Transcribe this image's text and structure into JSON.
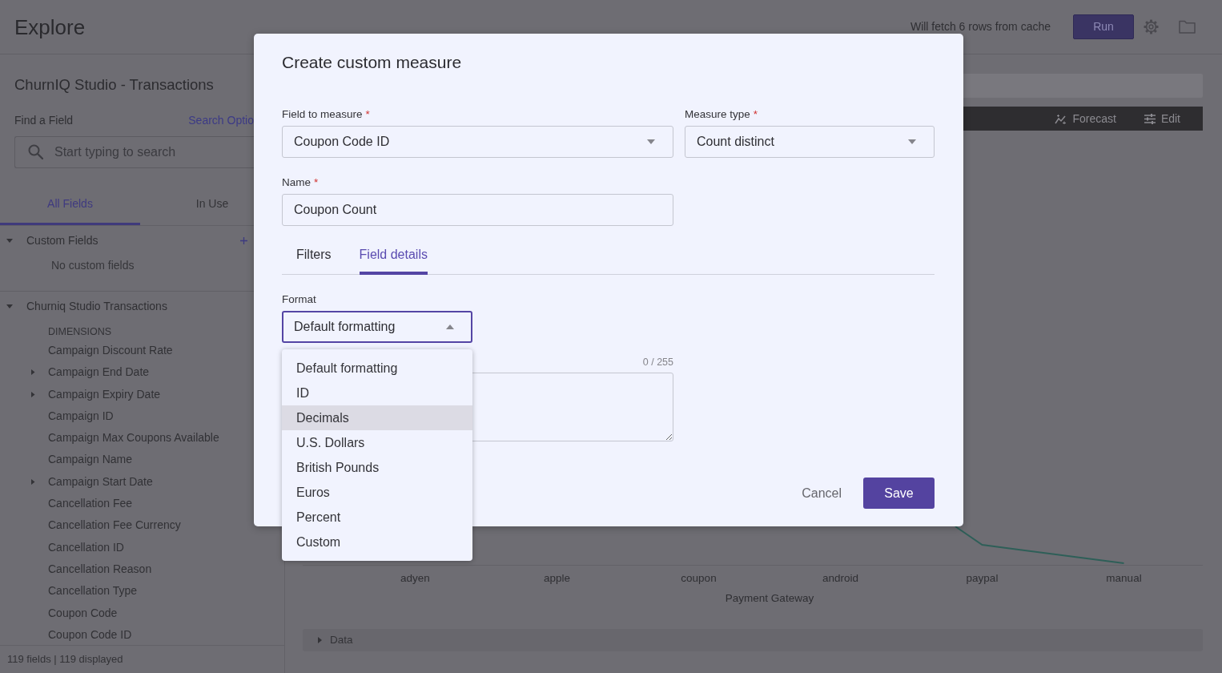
{
  "header": {
    "title": "Explore",
    "cache_note": "Will fetch 6 rows from cache",
    "run_label": "Run"
  },
  "sidebar": {
    "title": "ChurnIQ Studio - Transactions",
    "find_label": "Find a Field",
    "search_options": "Search Optio",
    "search": {
      "placeholder": "Start typing to search"
    },
    "tabs": [
      {
        "label": "All Fields",
        "selected": true
      },
      {
        "label": "In Use",
        "selected": false
      }
    ],
    "tree": [
      {
        "label": "Custom Fields",
        "expanded": true,
        "addable": true,
        "empty_text": "No custom fields"
      },
      {
        "label": "Churniq Studio Transactions",
        "expanded": true,
        "addable": false,
        "section_heading": "DIMENSIONS",
        "children": [
          {
            "label": "Campaign Discount Rate"
          },
          {
            "label": "Campaign End Date",
            "expanded": false
          },
          {
            "label": "Campaign Expiry Date",
            "expanded": false
          },
          {
            "label": "Campaign ID"
          },
          {
            "label": "Campaign Max Coupons Available"
          },
          {
            "label": "Campaign Name"
          },
          {
            "label": "Campaign Start Date",
            "expanded": false
          },
          {
            "label": "Cancellation Fee"
          },
          {
            "label": "Cancellation Fee Currency"
          },
          {
            "label": "Cancellation ID"
          },
          {
            "label": "Cancellation Reason"
          },
          {
            "label": "Cancellation Type"
          },
          {
            "label": "Coupon Code"
          },
          {
            "label": "Coupon Code ID"
          }
        ]
      }
    ],
    "footer": "119 fields | 119 displayed"
  },
  "main": {
    "toolbar": [
      {
        "kind": "forecast",
        "label": "Forecast"
      },
      {
        "kind": "edit",
        "label": "Edit"
      }
    ],
    "chart": {
      "categories": [
        "adyen",
        "apple",
        "coupon",
        "android",
        "paypal",
        "manual"
      ],
      "axis_title": "Payment Gateway"
    },
    "data_section": {
      "label": "Data",
      "expanded": false
    }
  },
  "modal": {
    "title": "Create custom measure",
    "field_to_measure": {
      "label": "Field to measure",
      "required_mark": "*",
      "value": "Coupon Code ID"
    },
    "measure_type": {
      "label": "Measure type",
      "required_mark": "*",
      "value": "Count distinct"
    },
    "name": {
      "label": "Name",
      "required_mark": "*",
      "value": "Coupon Count"
    },
    "tabs": [
      {
        "label": "Filters",
        "selected": false
      },
      {
        "label": "Field details",
        "selected": true
      }
    ],
    "format": {
      "label": "Format",
      "value": "Default formatting",
      "open": true,
      "options": [
        {
          "label": "Default formatting",
          "highlighted": false
        },
        {
          "label": "ID",
          "highlighted": false
        },
        {
          "label": "Decimals",
          "highlighted": true
        },
        {
          "label": "U.S. Dollars",
          "highlighted": false
        },
        {
          "label": "British Pounds",
          "highlighted": false
        },
        {
          "label": "Euros",
          "highlighted": false
        },
        {
          "label": "Percent",
          "highlighted": false
        },
        {
          "label": "Custom",
          "highlighted": false
        }
      ]
    },
    "description": {
      "counter": "0 / 255"
    },
    "buttons": {
      "cancel": "Cancel",
      "save": "Save"
    }
  }
}
